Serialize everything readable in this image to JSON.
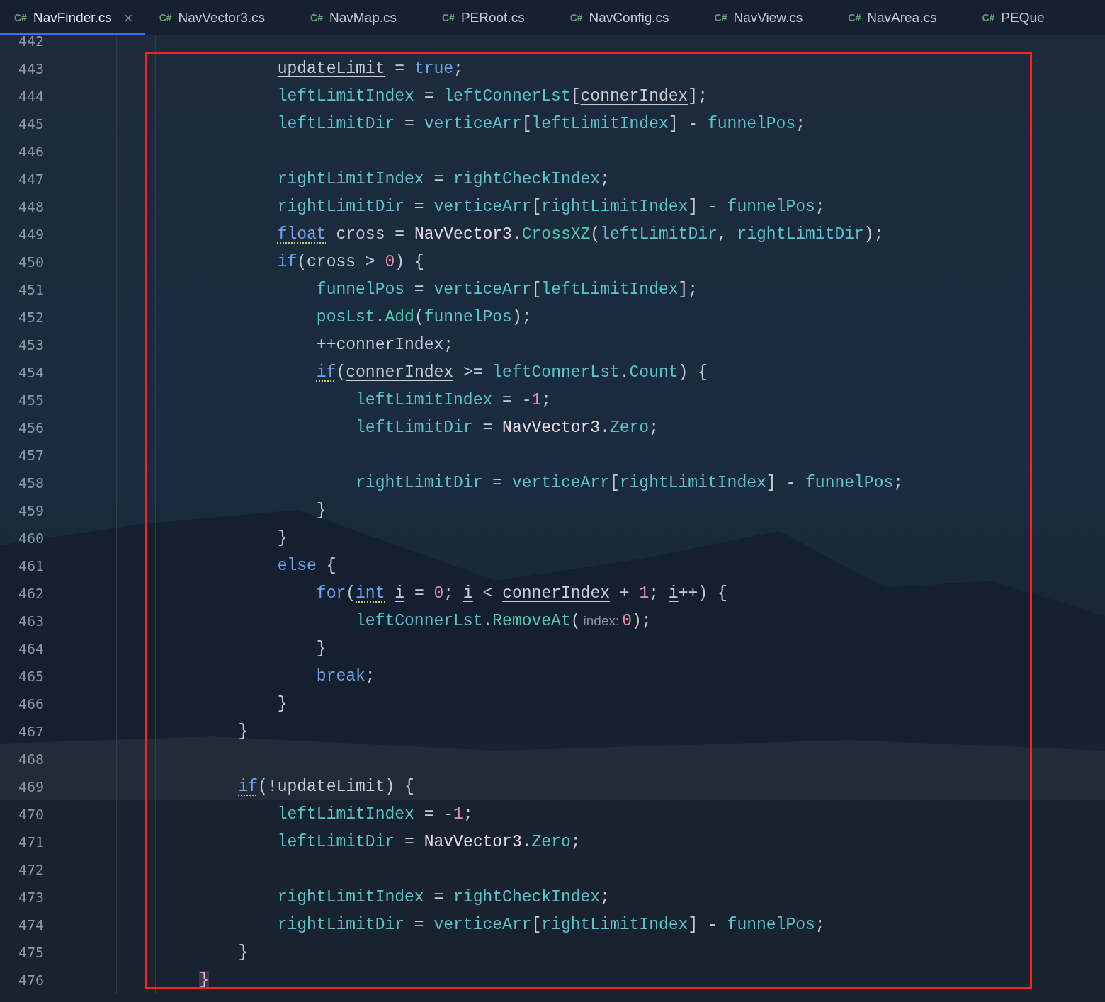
{
  "tabs": [
    {
      "lang": "C#",
      "label": "NavFinder.cs",
      "selected": true,
      "close": "×"
    },
    {
      "lang": "C#",
      "label": "NavVector3.cs",
      "selected": false
    },
    {
      "lang": "C#",
      "label": "NavMap.cs",
      "selected": false
    },
    {
      "lang": "C#",
      "label": "PERoot.cs",
      "selected": false
    },
    {
      "lang": "C#",
      "label": "NavConfig.cs",
      "selected": false
    },
    {
      "lang": "C#",
      "label": "NavView.cs",
      "selected": false
    },
    {
      "lang": "C#",
      "label": "NavArea.cs",
      "selected": false
    },
    {
      "lang": "C#",
      "label": "PEQue",
      "selected": false
    }
  ],
  "annotation": {
    "kind": "rectangle",
    "color": "#ff1f1f"
  },
  "lines": [
    {
      "number": "442"
    },
    {
      "number": "443",
      "tokens": [
        {
          "t": "            updateLimit",
          "kind": "reflocal"
        },
        {
          "t": " = ",
          "kind": "punct"
        },
        {
          "t": "true",
          "kind": "keyword"
        },
        {
          "t": ";",
          "kind": "punct"
        }
      ]
    },
    {
      "number": "444",
      "tokens": [
        {
          "t": "            leftLimitIndex",
          "kind": "field"
        },
        {
          "t": " = ",
          "kind": "punct"
        },
        {
          "t": "leftConnerLst",
          "kind": "field"
        },
        {
          "t": "[",
          "kind": "punct"
        },
        {
          "t": "connerIndex",
          "kind": "reflocal"
        },
        {
          "t": "];",
          "kind": "punct"
        }
      ]
    },
    {
      "number": "445",
      "tokens": [
        {
          "t": "            leftLimitDir",
          "kind": "field"
        },
        {
          "t": " = ",
          "kind": "punct"
        },
        {
          "t": "verticeArr",
          "kind": "field"
        },
        {
          "t": "[",
          "kind": "punct"
        },
        {
          "t": "leftLimitIndex",
          "kind": "field"
        },
        {
          "t": "] -",
          "kind": "punct"
        },
        {
          "t": " funnelPos",
          "kind": "field"
        },
        {
          "t": ";",
          "kind": "punct"
        }
      ]
    },
    {
      "number": "446"
    },
    {
      "number": "447",
      "tokens": [
        {
          "t": "            rightLimitIndex",
          "kind": "field"
        },
        {
          "t": " = ",
          "kind": "punct"
        },
        {
          "t": "rightCheckIndex",
          "kind": "field"
        },
        {
          "t": ";",
          "kind": "punct"
        }
      ]
    },
    {
      "number": "448",
      "tokens": [
        {
          "t": "            rightLimitDir",
          "kind": "field"
        },
        {
          "t": " = ",
          "kind": "punct"
        },
        {
          "t": "verticeArr",
          "kind": "field"
        },
        {
          "t": "[",
          "kind": "punct"
        },
        {
          "t": "rightLimitIndex",
          "kind": "field"
        },
        {
          "t": "] -",
          "kind": "punct"
        },
        {
          "t": " funnelPos",
          "kind": "field"
        },
        {
          "t": ";",
          "kind": "punct"
        }
      ]
    },
    {
      "number": "449",
      "tokens": [
        {
          "t": "            float",
          "kind": "flagkeyword"
        },
        {
          "t": " cross = ",
          "kind": "punct"
        },
        {
          "t": "NavVector3",
          "kind": "type"
        },
        {
          "t": ".",
          "kind": "punct"
        },
        {
          "t": "CrossXZ",
          "kind": "method"
        },
        {
          "t": "(",
          "kind": "punct"
        },
        {
          "t": "leftLimitDir",
          "kind": "field"
        },
        {
          "t": ", ",
          "kind": "punct"
        },
        {
          "t": "rightLimitDir",
          "kind": "field"
        },
        {
          "t": ");",
          "kind": "punct"
        }
      ]
    },
    {
      "number": "450",
      "tokens": [
        {
          "t": "            if",
          "kind": "keyword"
        },
        {
          "t": "(cross > ",
          "kind": "punct"
        },
        {
          "t": "0",
          "kind": "number"
        },
        {
          "t": ") {",
          "kind": "punct"
        }
      ]
    },
    {
      "number": "451",
      "tokens": [
        {
          "t": "                funnelPos",
          "kind": "field"
        },
        {
          "t": " = ",
          "kind": "punct"
        },
        {
          "t": "verticeArr",
          "kind": "field"
        },
        {
          "t": "[",
          "kind": "punct"
        },
        {
          "t": "leftLimitIndex",
          "kind": "field"
        },
        {
          "t": "];",
          "kind": "punct"
        }
      ]
    },
    {
      "number": "452",
      "tokens": [
        {
          "t": "                posLst",
          "kind": "field"
        },
        {
          "t": ".",
          "kind": "punct"
        },
        {
          "t": "Add",
          "kind": "method"
        },
        {
          "t": "(",
          "kind": "punct"
        },
        {
          "t": "funnelPos",
          "kind": "field"
        },
        {
          "t": ");",
          "kind": "punct"
        }
      ]
    },
    {
      "number": "453",
      "tokens": [
        {
          "t": "                ++",
          "kind": "punct"
        },
        {
          "t": "connerIndex",
          "kind": "reflocal"
        },
        {
          "t": ";",
          "kind": "punct"
        }
      ]
    },
    {
      "number": "454",
      "tokens": [
        {
          "t": "                if",
          "kind": "flagkeyword"
        },
        {
          "t": "(",
          "kind": "punct"
        },
        {
          "t": "connerIndex",
          "kind": "reflocal"
        },
        {
          "t": " >= ",
          "kind": "punct"
        },
        {
          "t": "leftConnerLst",
          "kind": "field"
        },
        {
          "t": ".",
          "kind": "punct"
        },
        {
          "t": "Count",
          "kind": "field"
        },
        {
          "t": ") {",
          "kind": "punct"
        }
      ]
    },
    {
      "number": "455",
      "tokens": [
        {
          "t": "                    leftLimitIndex",
          "kind": "field"
        },
        {
          "t": " = -",
          "kind": "punct"
        },
        {
          "t": "1",
          "kind": "number"
        },
        {
          "t": ";",
          "kind": "punct"
        }
      ]
    },
    {
      "number": "456",
      "tokens": [
        {
          "t": "                    leftLimitDir",
          "kind": "field"
        },
        {
          "t": " = ",
          "kind": "punct"
        },
        {
          "t": "NavVector3",
          "kind": "type"
        },
        {
          "t": ".",
          "kind": "punct"
        },
        {
          "t": "Zero",
          "kind": "field"
        },
        {
          "t": ";",
          "kind": "punct"
        }
      ]
    },
    {
      "number": "457"
    },
    {
      "number": "458",
      "tokens": [
        {
          "t": "                    rightLimitDir",
          "kind": "field"
        },
        {
          "t": " = ",
          "kind": "punct"
        },
        {
          "t": "verticeArr",
          "kind": "field"
        },
        {
          "t": "[",
          "kind": "punct"
        },
        {
          "t": "rightLimitIndex",
          "kind": "field"
        },
        {
          "t": "] -",
          "kind": "punct"
        },
        {
          "t": " funnelPos",
          "kind": "field"
        },
        {
          "t": ";",
          "kind": "punct"
        }
      ]
    },
    {
      "number": "459",
      "tokens": [
        {
          "t": "                }",
          "kind": "punct"
        }
      ]
    },
    {
      "number": "460",
      "tokens": [
        {
          "t": "            }",
          "kind": "punct"
        }
      ]
    },
    {
      "number": "461",
      "tokens": [
        {
          "t": "            else",
          "kind": "keyword"
        },
        {
          "t": " {",
          "kind": "punct"
        }
      ]
    },
    {
      "number": "462",
      "tokens": [
        {
          "t": "                for",
          "kind": "keyword"
        },
        {
          "t": "(",
          "kind": "punct"
        },
        {
          "t": "int",
          "kind": "flagkeyword"
        },
        {
          "t": " i",
          "kind": "reflocal"
        },
        {
          "t": " = ",
          "kind": "punct"
        },
        {
          "t": "0",
          "kind": "number"
        },
        {
          "t": "; ",
          "kind": "punct"
        },
        {
          "t": "i",
          "kind": "reflocal"
        },
        {
          "t": " < ",
          "kind": "punct"
        },
        {
          "t": "connerIndex",
          "kind": "reflocal"
        },
        {
          "t": " + ",
          "kind": "punct"
        },
        {
          "t": "1",
          "kind": "number"
        },
        {
          "t": "; ",
          "kind": "punct"
        },
        {
          "t": "i",
          "kind": "reflocal"
        },
        {
          "t": "++) {",
          "kind": "punct"
        }
      ]
    },
    {
      "number": "463",
      "tokens": [
        {
          "t": "                    leftConnerLst",
          "kind": "field"
        },
        {
          "t": ".",
          "kind": "punct"
        },
        {
          "t": "RemoveAt",
          "kind": "method"
        },
        {
          "t": "(",
          "kind": "punct"
        },
        {
          "t": "index:",
          "kind": "hint"
        },
        {
          "t": "0",
          "kind": "number"
        },
        {
          "t": ");",
          "kind": "punct"
        }
      ]
    },
    {
      "number": "464",
      "tokens": [
        {
          "t": "                }",
          "kind": "punct"
        }
      ]
    },
    {
      "number": "465",
      "tokens": [
        {
          "t": "                break",
          "kind": "keyword"
        },
        {
          "t": ";",
          "kind": "punct"
        }
      ]
    },
    {
      "number": "466",
      "tokens": [
        {
          "t": "            }",
          "kind": "punct"
        }
      ]
    },
    {
      "number": "467",
      "tokens": [
        {
          "t": "        }",
          "kind": "punct"
        }
      ]
    },
    {
      "number": "468"
    },
    {
      "number": "469",
      "tokens": [
        {
          "t": "        if",
          "kind": "flagkeyword"
        },
        {
          "t": "(!",
          "kind": "punct"
        },
        {
          "t": "updateLimit",
          "kind": "reflocal"
        },
        {
          "t": ") {",
          "kind": "punct"
        }
      ]
    },
    {
      "number": "470",
      "tokens": [
        {
          "t": "            leftLimitIndex",
          "kind": "field"
        },
        {
          "t": " = -",
          "kind": "punct"
        },
        {
          "t": "1",
          "kind": "number"
        },
        {
          "t": ";",
          "kind": "punct"
        }
      ]
    },
    {
      "number": "471",
      "tokens": [
        {
          "t": "            leftLimitDir",
          "kind": "field"
        },
        {
          "t": " = ",
          "kind": "punct"
        },
        {
          "t": "NavVector3",
          "kind": "type"
        },
        {
          "t": ".",
          "kind": "punct"
        },
        {
          "t": "Zero",
          "kind": "field"
        },
        {
          "t": ";",
          "kind": "punct"
        }
      ]
    },
    {
      "number": "472"
    },
    {
      "number": "473",
      "tokens": [
        {
          "t": "            rightLimitIndex",
          "kind": "field"
        },
        {
          "t": " = ",
          "kind": "punct"
        },
        {
          "t": "rightCheckIndex",
          "kind": "field"
        },
        {
          "t": ";",
          "kind": "punct"
        }
      ]
    },
    {
      "number": "474",
      "tokens": [
        {
          "t": "            rightLimitDir",
          "kind": "field"
        },
        {
          "t": " = ",
          "kind": "punct"
        },
        {
          "t": "verticeArr",
          "kind": "field"
        },
        {
          "t": "[",
          "kind": "punct"
        },
        {
          "t": "rightLimitIndex",
          "kind": "field"
        },
        {
          "t": "] -",
          "kind": "punct"
        },
        {
          "t": " funnelPos",
          "kind": "field"
        },
        {
          "t": ";",
          "kind": "punct"
        }
      ]
    },
    {
      "number": "475",
      "tokens": [
        {
          "t": "        }",
          "kind": "punct"
        }
      ]
    },
    {
      "number": "476",
      "tokens": [
        {
          "t": "    }",
          "kind": "matchbrace"
        }
      ]
    }
  ]
}
